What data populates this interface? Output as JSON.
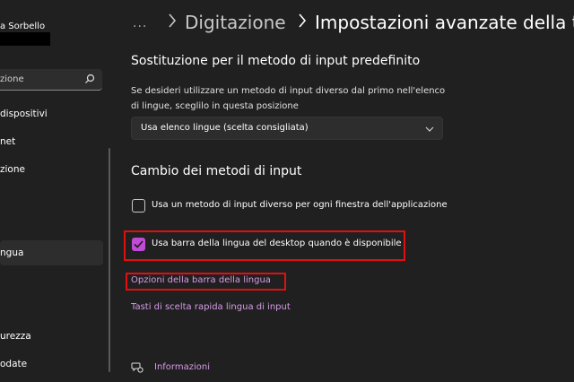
{
  "sidebar": {
    "account_name": "a Sorbello",
    "search_text": "zione",
    "items": [
      {
        "label": "dispositivi"
      },
      {
        "label": "net"
      },
      {
        "label": "zione"
      },
      {
        "label": "ngua"
      },
      {
        "label": "urezza"
      },
      {
        "label": "odate"
      }
    ]
  },
  "header": {
    "more": "···",
    "crumb_1": "Digitazione",
    "crumb_2": "Impostazioni avanzate della ta"
  },
  "main": {
    "section1": {
      "title": "Sostituzione per il metodo di input predefinito",
      "description": "Se desideri utilizzare un metodo di input diverso dal primo nell'elenco di lingue, sceglilo in questa posizione",
      "dropdown_value": "Usa elenco lingue (scelta consigliata)"
    },
    "section2": {
      "title": "Cambio dei metodi di input",
      "checkbox1": {
        "label": "Usa un metodo di input diverso per ogni finestra dell'applicazione",
        "checked": false
      },
      "checkbox2": {
        "label": "Usa barra della lingua del desktop quando è disponibile",
        "checked": true
      }
    },
    "links": {
      "language_bar_options": "Opzioni della barra della lingua",
      "hotkeys": "Tasti di scelta rapida lingua di input"
    },
    "info_link": "Informazioni"
  },
  "colors": {
    "background": "#202020",
    "accent": "#c04bd6",
    "link": "#d79be8",
    "highlight_border": "#e01010"
  }
}
